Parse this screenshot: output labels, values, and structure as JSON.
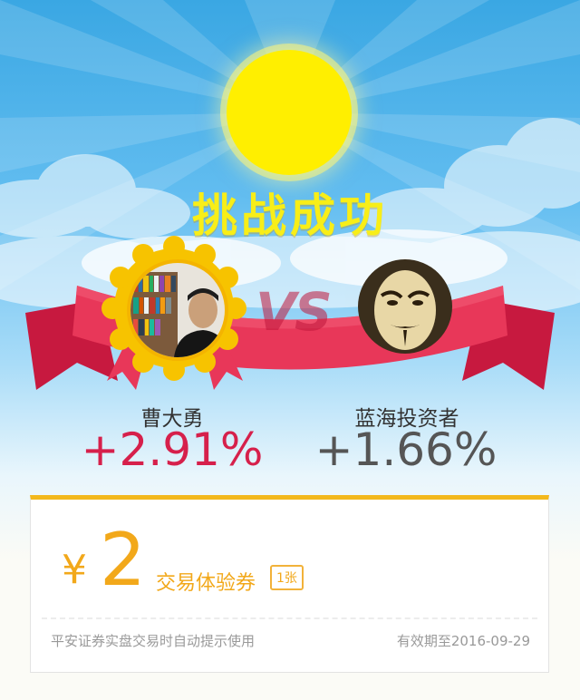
{
  "title": "挑战成功",
  "vs": "VS",
  "players": {
    "left": {
      "name": "曹大勇",
      "return": "+2.91%"
    },
    "right": {
      "name": "蓝海投资者",
      "return": "+1.66%"
    }
  },
  "voucher": {
    "currency": "¥",
    "amount": "2",
    "type": "交易体验券",
    "count": "1张",
    "note": "平安证券实盘交易时自动提示使用",
    "expiry": "有效期至2016-09-29"
  },
  "colors": {
    "title": "#f8ee18",
    "sun": "#ffef00",
    "ribbon": "#e83759",
    "positive_return": "#d6204b",
    "neutral_return": "#555555",
    "voucher_accent": "#f2a81a"
  },
  "icons": {
    "sun": "sun-icon",
    "winner_badge": "gold-medal-badge",
    "left_avatar": "avatar-photo-man-bookshelf",
    "right_avatar": "avatar-guy-fawkes-mask"
  }
}
